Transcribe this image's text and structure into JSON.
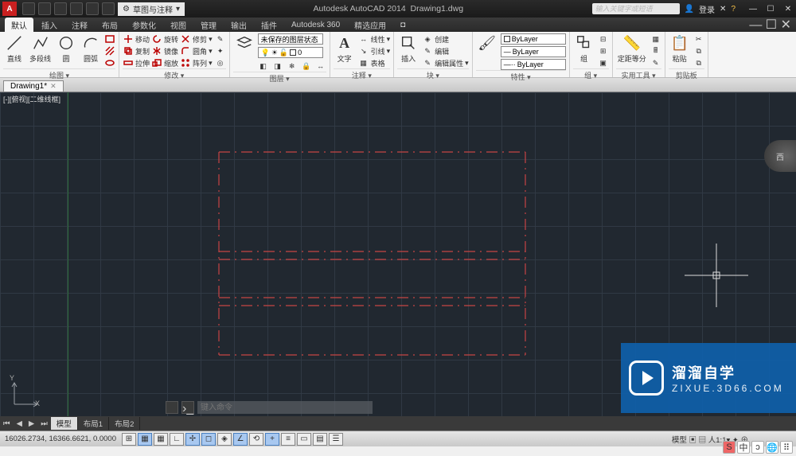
{
  "title": {
    "app": "Autodesk AutoCAD 2014",
    "doc": "Drawing1.dwg",
    "workspace": "草图与注释"
  },
  "search": {
    "placeholder": "输入关键字或短语"
  },
  "user": {
    "label": "登录"
  },
  "tabs": [
    "默认",
    "插入",
    "注释",
    "布局",
    "参数化",
    "视图",
    "管理",
    "输出",
    "插件",
    "Autodesk 360",
    "精选应用",
    "◘"
  ],
  "active_tab": "默认",
  "ribbon": {
    "draw": {
      "title": "绘图 ▾",
      "line": "直线",
      "pline": "多段线",
      "circle": "圆",
      "arc": "圆弧"
    },
    "modify": {
      "title": "修改 ▾",
      "move": "移动",
      "rotate": "旋转",
      "trim": "修剪",
      "copy": "复制",
      "mirror": "镜像",
      "fillet": "圆角",
      "stretch": "拉伸",
      "scale": "缩放",
      "array": "阵列"
    },
    "layer": {
      "title": "图层 ▾",
      "unsaved": "未保存的图层状态",
      "zero": "0"
    },
    "annot": {
      "title": "注释 ▾",
      "text": "文字",
      "linear": "线性",
      "leader": "引线",
      "table": "表格"
    },
    "block": {
      "title": "块 ▾",
      "insert": "插入",
      "create": "创建",
      "edit": "编辑",
      "editattr": "编辑属性"
    },
    "prop": {
      "title": "特性 ▾",
      "bylayer": "ByLayer"
    },
    "group": {
      "title": "组 ▾",
      "label": "组"
    },
    "util": {
      "title": "实用工具 ▾",
      "measure": "定距等分"
    },
    "clip": {
      "title": "剪贴板",
      "paste": "粘贴"
    }
  },
  "doc_tab": "Drawing1*",
  "viewport": {
    "label": "[-][俯视][二维线框]",
    "cube": "西"
  },
  "layout": {
    "model": "模型",
    "l1": "布局1",
    "l2": "布局2"
  },
  "cmd": {
    "placeholder": "键入命令"
  },
  "status": {
    "coords": "16026.2734, 16366.6621, 0.0000",
    "right": "模型 ▣ ▤    人1:1▾  ✦  ⊕"
  },
  "watermark": {
    "t1": "溜溜自学",
    "t2": "ZIXUE.3D66.COM"
  },
  "ime": {
    "a": "S",
    "b": "中",
    "c": "ᴐ",
    "d": "🌐",
    "e": "⠿"
  }
}
